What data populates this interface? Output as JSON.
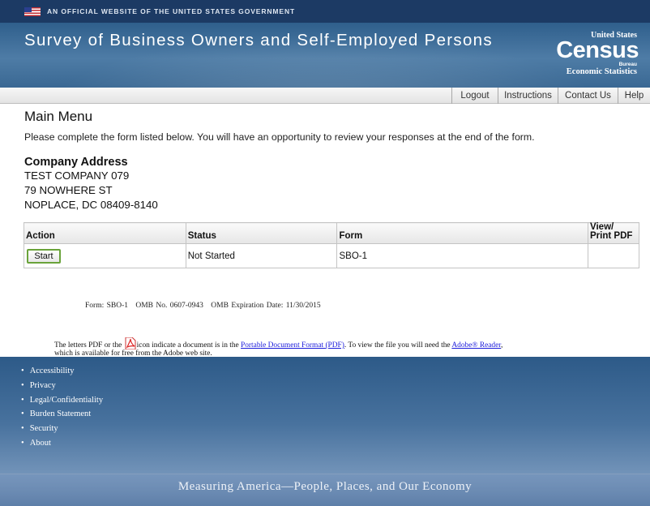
{
  "gov_banner": {
    "text": "AN OFFICIAL WEBSITE OF THE UNITED STATES GOVERNMENT",
    "flag_icon": "us-flag-icon"
  },
  "header": {
    "title": "Survey of Business Owners and Self-Employed Persons",
    "logo": {
      "united_states": "United States",
      "census": "Census",
      "bureau": "Bureau",
      "subtitle": "Economic Statistics"
    }
  },
  "nav": {
    "logout": "Logout",
    "instructions": "Instructions",
    "contact": "Contact Us",
    "help": "Help"
  },
  "main": {
    "title": "Main Menu",
    "intro": "Please complete the form listed below. You will have an opportunity to review your responses at the end of the form.",
    "address": {
      "heading": "Company Address",
      "line1": "TEST COMPANY 079",
      "line2": "79 NOWHERE ST",
      "line3": "NOPLACE,  DC  08409-8140"
    },
    "table": {
      "headers": {
        "action": "Action",
        "status": "Status",
        "form": "Form",
        "view": "View/ Print PDF"
      },
      "rows": [
        {
          "action_label": "Start",
          "status": "Not Started",
          "form": "SBO-1",
          "view": ""
        }
      ]
    },
    "omb": {
      "form": "Form: SBO-1",
      "omb_no": "OMB No. 0607-0943",
      "expiration": "OMB Expiration Date: 11/30/2015"
    },
    "pdf_note": {
      "part1": "The letters PDF or the",
      "part2": "icon indicate a document is in the",
      "link1": "Portable Document Format (PDF)",
      "part3": ". To view the file you will need the",
      "link2": "Adobe® Reader",
      "part4": ",",
      "part5": "which is available for free from the Adobe web site.",
      "icon": "pdf-icon"
    }
  },
  "footer": {
    "links": [
      "Accessibility",
      "Privacy",
      "Legal/Confidentiality",
      "Burden Statement",
      "Security",
      "About"
    ],
    "tagline": "Measuring America—People, Places, and Our Economy"
  },
  "colors": {
    "banner": "#1c3a64",
    "header": "#3f6d98",
    "button_border": "#6aa33a",
    "link": "#1a1adb"
  }
}
